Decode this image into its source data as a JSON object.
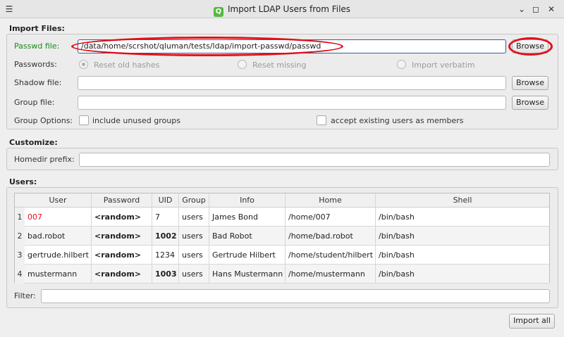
{
  "window": {
    "title": "Import LDAP Users from Files",
    "app_icon_glyph": "Q",
    "menu_icon": "menu-icon",
    "controls": [
      "minimize-icon",
      "maximize-icon",
      "close-icon"
    ]
  },
  "import_files": {
    "title": "Import Files:",
    "passwd_label": "Passwd file:",
    "passwd_value": "/data/home/scrshot/qluman/tests/ldap/import-passwd/passwd",
    "browse_label": "Browse",
    "passwords_label": "Passwords:",
    "radio_options": [
      "Reset old hashes",
      "Reset missing",
      "Import verbatim"
    ],
    "shadow_label": "Shadow file:",
    "shadow_value": "",
    "group_label": "Group file:",
    "group_value": "",
    "group_options_label": "Group Options:",
    "include_unused_label": "include unused groups",
    "accept_existing_label": "accept existing users as members"
  },
  "customize": {
    "title": "Customize:",
    "homedir_label": "Homedir prefix:",
    "homedir_value": ""
  },
  "users": {
    "title": "Users:",
    "columns": [
      "User",
      "Password",
      "UID",
      "Group",
      "Info",
      "Home",
      "Shell"
    ],
    "rows": [
      {
        "num": "1",
        "user": "007",
        "password": "<random>",
        "uid": "7",
        "group": "users",
        "info": "James Bond",
        "home": "/home/007",
        "shell": "/bin/bash"
      },
      {
        "num": "2",
        "user": "bad.robot",
        "password": "<random>",
        "uid": "1002",
        "group": "users",
        "info": "Bad Robot",
        "home": "/home/bad.robot",
        "shell": "/bin/bash"
      },
      {
        "num": "3",
        "user": "gertrude.hilbert",
        "password": "<random>",
        "uid": "1234",
        "group": "users",
        "info": "Gertrude Hilbert",
        "home": "/home/student/hilbert",
        "shell": "/bin/bash"
      },
      {
        "num": "4",
        "user": "mustermann",
        "password": "<random>",
        "uid": "1003",
        "group": "users",
        "info": "Hans Mustermann",
        "home": "/home/mustermann",
        "shell": "/bin/bash"
      }
    ],
    "filter_label": "Filter:",
    "filter_value": "",
    "import_all_label": "Import all"
  },
  "colors": {
    "highlight_red": "#e0101a",
    "label_green": "#1b8a1b"
  }
}
